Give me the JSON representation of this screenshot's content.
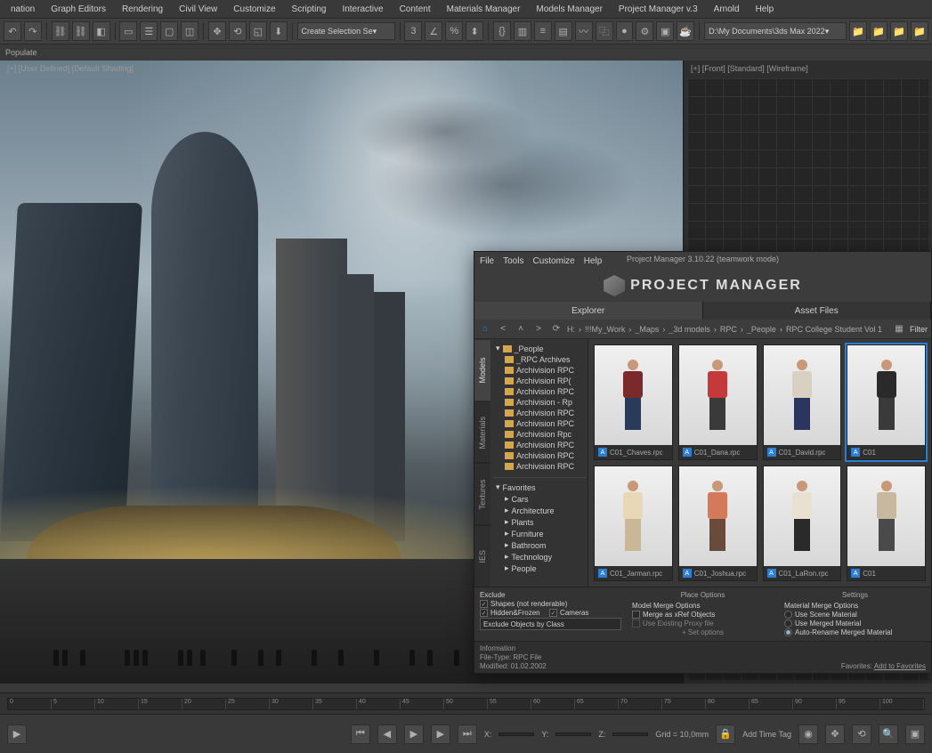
{
  "mainMenu": [
    "nation",
    "Graph Editors",
    "Rendering",
    "Civil View",
    "Customize",
    "Scripting",
    "Interactive",
    "Content",
    "Materials Manager",
    "Models Manager",
    "Project Manager v.3",
    "Arnold",
    "Help"
  ],
  "toolbarSelect": "Create Selection Se",
  "pathField": "D:\\My Documents\\3ds Max 2022",
  "subBar": "Populate",
  "viewportLeft": "[+] [User Defined] [Default Shading]",
  "viewportRight": "[+] [Front] [Standard] [Wireframe]",
  "pm": {
    "menu": [
      "File",
      "Tools",
      "Customize",
      "Help"
    ],
    "title": "Project Manager 3.10.22 (teamwork mode)",
    "logo": "PROJECT MANAGER",
    "tabs": [
      "Explorer",
      "Asset Files"
    ],
    "activeTab": 0,
    "sideTabs": [
      "Models",
      "Materials",
      "Textures",
      "IES"
    ],
    "activeSideTab": 0,
    "crumbs": [
      "H:",
      "!!!My_Work",
      "_Maps",
      "_3d models",
      "RPC",
      "_People",
      "RPC College Student Vol 1"
    ],
    "filterLabel": "Filter",
    "tree": {
      "root": "_People",
      "items": [
        "_RPC Archives",
        "Archivision RPC",
        "Archivision RP(",
        "Archivision RPC",
        "Archivision - Rp",
        "Archivision RPC",
        "Archivision RPC",
        "Archivision Rpc",
        "Archivision RPC",
        "Archivision RPC",
        "Archivision RPC"
      ],
      "favoritesLabel": "Favorites",
      "favorites": [
        "Cars",
        "Architecture",
        "Plants",
        "Furniture",
        "Bathroom",
        "Technology",
        "People"
      ]
    },
    "thumbs": [
      {
        "label": "C01_Chaves.rpc",
        "shirt": "#7a2a2a",
        "pants": "#2a3a5a"
      },
      {
        "label": "C01_Dana.rpc",
        "shirt": "#c43a3a",
        "pants": "#3a3a3a"
      },
      {
        "label": "C01_David.rpc",
        "shirt": "#d8d0c0",
        "pants": "#2a3560"
      },
      {
        "label": "C01",
        "shirt": "#2a2a2a",
        "pants": "#3a3a3a",
        "selected": true
      },
      {
        "label": "C01_Jarman.rpc",
        "shirt": "#e8d8b8",
        "pants": "#c8b898"
      },
      {
        "label": "C01_Joshua.rpc",
        "shirt": "#d47a5a",
        "pants": "#6a4a3a"
      },
      {
        "label": "C01_LaRon.rpc",
        "shirt": "#e8e0d0",
        "pants": "#2a2a2a"
      },
      {
        "label": "C01",
        "shirt": "#c8b8a0",
        "pants": "#4a4a4a"
      }
    ],
    "options": {
      "placeTitle": "Place Options",
      "settingsTitle": "Settings",
      "excludeTitle": "Exclude",
      "excludeShapes": "Shapes (not renderable)",
      "excludeHidden": "Hidden&Frozen",
      "excludeCameras": "Cameras",
      "excludeClass": "Exclude Objects by Class",
      "mergeTitle": "Model Merge Options",
      "mergeXref": "Merge as xRef Objects",
      "mergeProxy": "Use Existing Proxy file",
      "mergeMore": "+ Set options",
      "matTitle": "Material Merge Options",
      "matScene": "Use Scene Material",
      "matMerged": "Use Merged Material",
      "matAuto": "Auto-Rename Merged Material"
    },
    "info": {
      "title": "Information",
      "fileType": "File-Type:   RPC File",
      "modified": "Modified:   01.02.2002",
      "favorites": "Favorites:",
      "addFav": "Add to Favorites"
    }
  },
  "timeline": {
    "ticks": [
      "0",
      "5",
      "10",
      "15",
      "20",
      "25",
      "30",
      "35",
      "40",
      "45",
      "50",
      "55",
      "60",
      "65",
      "70",
      "75",
      "80",
      "85",
      "90",
      "95",
      "100"
    ]
  },
  "status": {
    "x": "X:",
    "y": "Y:",
    "z": "Z:",
    "grid": "Grid = 10,0mm",
    "addTag": "Add Time Tag",
    "play": "▶"
  }
}
